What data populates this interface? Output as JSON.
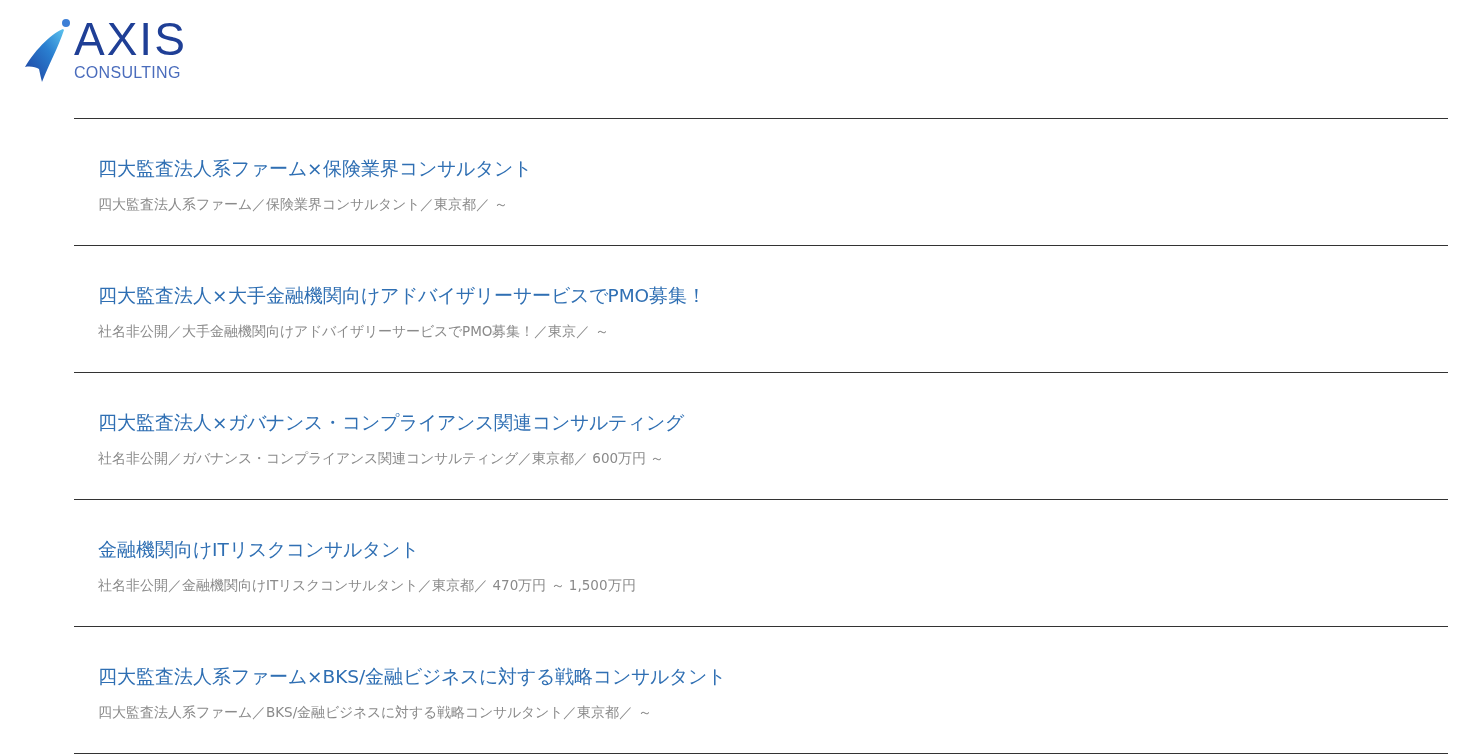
{
  "logo": {
    "name": "AXIS",
    "tagline": "CONSULTING"
  },
  "jobs": [
    {
      "title": "四大監査法人系ファーム×保険業界コンサルタント",
      "details": "四大監査法人系ファーム／保険業界コンサルタント／東京都／ ～"
    },
    {
      "title": "四大監査法人×大手金融機関向けアドバイザリーサービスでPMO募集！",
      "details": "社名非公開／大手金融機関向けアドバイザリーサービスでPMO募集！／東京／ ～"
    },
    {
      "title": "四大監査法人×ガバナンス・コンプライアンス関連コンサルティング",
      "details": "社名非公開／ガバナンス・コンプライアンス関連コンサルティング／東京都／ 600万円 ～"
    },
    {
      "title": "金融機関向けITリスクコンサルタント",
      "details": "社名非公開／金融機関向けITリスクコンサルタント／東京都／ 470万円 ～ 1,500万円"
    },
    {
      "title": "四大監査法人系ファーム×BKS/金融ビジネスに対する戦略コンサルタント",
      "details": "四大監査法人系ファーム／BKS/金融ビジネスに対する戦略コンサルタント／東京都／ ～"
    }
  ]
}
